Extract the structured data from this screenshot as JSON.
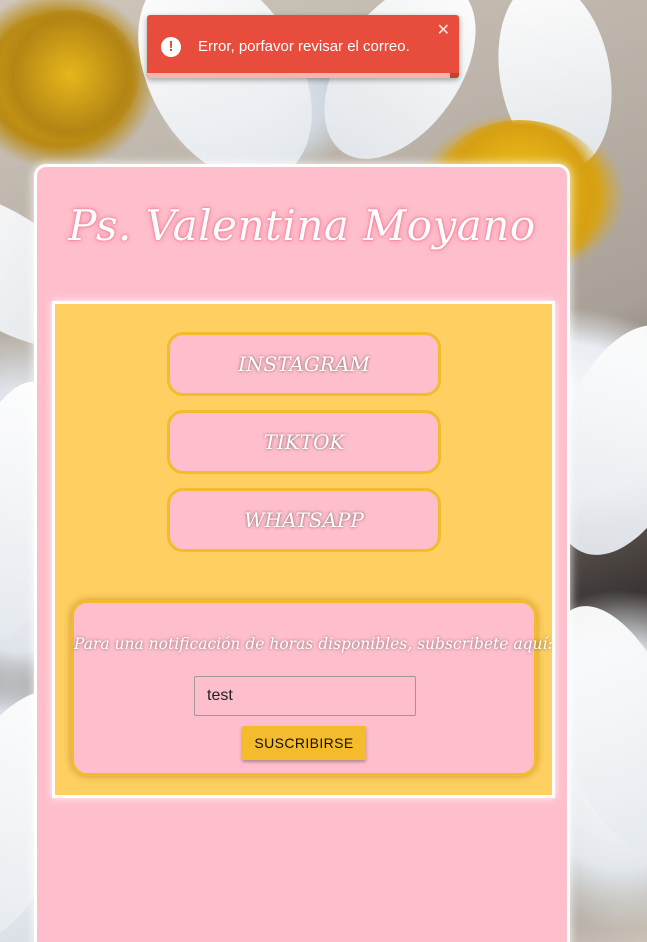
{
  "colors": {
    "card_background": "#ffbecb",
    "panel_background": "#ffd061",
    "accent_border": "#f4bb2c",
    "toast_background": "#e74c3c"
  },
  "profile": {
    "title": "Ps. Valentina Moyano"
  },
  "links": [
    {
      "label": "INSTAGRAM"
    },
    {
      "label": "TIKTOK"
    },
    {
      "label": "WHATSAPP"
    }
  ],
  "subscribe": {
    "prompt": "Para una notificación de horas disponibles, subscribete aquí:",
    "email_value": "test",
    "button_label": "SUSCRIBIRSE"
  },
  "toast": {
    "icon": "error-icon",
    "message": "Error, porfavor revisar el correo.",
    "close_icon": "close-icon",
    "progress": 0.97
  }
}
